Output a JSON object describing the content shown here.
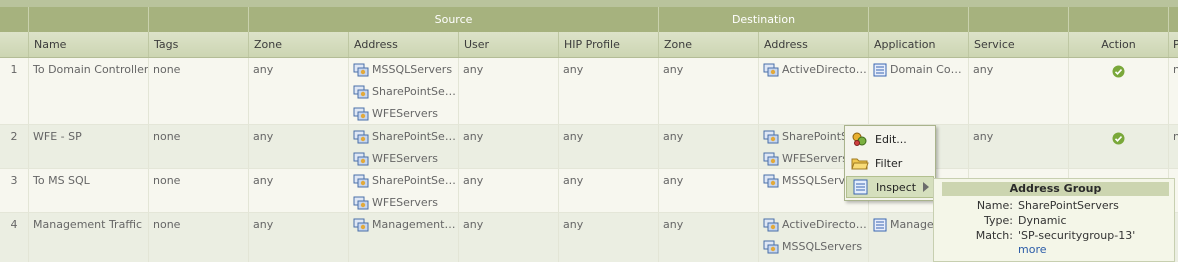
{
  "header_groups": {
    "source": "Source",
    "destination": "Destination"
  },
  "columns": {
    "name": "Name",
    "tags": "Tags",
    "src_zone": "Zone",
    "src_address": "Address",
    "src_user": "User",
    "src_hip": "HIP Profile",
    "dst_zone": "Zone",
    "dst_address": "Address",
    "application": "Application",
    "service": "Service",
    "action": "Action",
    "cut": "P"
  },
  "rows": [
    {
      "index": "1",
      "name": "To Domain Controller",
      "tags": "none",
      "src_zone": "any",
      "src_address": [
        "MSSQLServers",
        "SharePointServ...",
        "WFEServers"
      ],
      "src_user": "any",
      "src_hip": "any",
      "dst_zone": "any",
      "dst_address": [
        "ActiveDirectory..."
      ],
      "application": "Domain Cont...",
      "service": "any",
      "action": "allow",
      "cut": "n"
    },
    {
      "index": "2",
      "name": "WFE - SP",
      "tags": "none",
      "src_zone": "any",
      "src_address": [
        "SharePointServ...",
        "WFEServers"
      ],
      "src_user": "any",
      "src_hip": "any",
      "dst_zone": "any",
      "dst_address": [
        "SharePointSe",
        "WFEServers"
      ],
      "application": "",
      "service": "any",
      "action": "allow",
      "cut": "n"
    },
    {
      "index": "3",
      "name": "To MS SQL",
      "tags": "none",
      "src_zone": "any",
      "src_address": [
        "SharePointServ...",
        "WFEServers"
      ],
      "src_user": "any",
      "src_hip": "any",
      "dst_zone": "any",
      "dst_address": [
        "MSSQLServer"
      ],
      "application": "",
      "service": "",
      "action": "",
      "cut": ""
    },
    {
      "index": "4",
      "name": "Management Traffic",
      "tags": "none",
      "src_zone": "any",
      "src_address": [
        "ManagementSe..."
      ],
      "src_user": "any",
      "src_hip": "any",
      "dst_zone": "any",
      "dst_address": [
        "ActiveDirectory...",
        "MSSQLServers"
      ],
      "application": "Manager",
      "service": "",
      "action": "",
      "cut": ""
    }
  ],
  "context_menu": {
    "items": [
      {
        "label": "Edit...",
        "icon": "edit-icon"
      },
      {
        "label": "Filter",
        "icon": "filter-folder-icon"
      },
      {
        "label": "Inspect",
        "icon": "inspect-list-icon",
        "submenu": true
      }
    ]
  },
  "tooltip": {
    "title": "Address Group",
    "name_label": "Name:",
    "name_value": "SharePointServers",
    "type_label": "Type:",
    "type_value": "Dynamic",
    "match_label": "Match:",
    "match_value": "'SP-securitygroup-13'",
    "more": "more"
  },
  "colors": {
    "header_dark": "#a6b27e",
    "header_light": "#d6ddbf",
    "row_alt": "#ebeee2",
    "link": "#2b5ca8",
    "allow": "#7aa83a"
  }
}
